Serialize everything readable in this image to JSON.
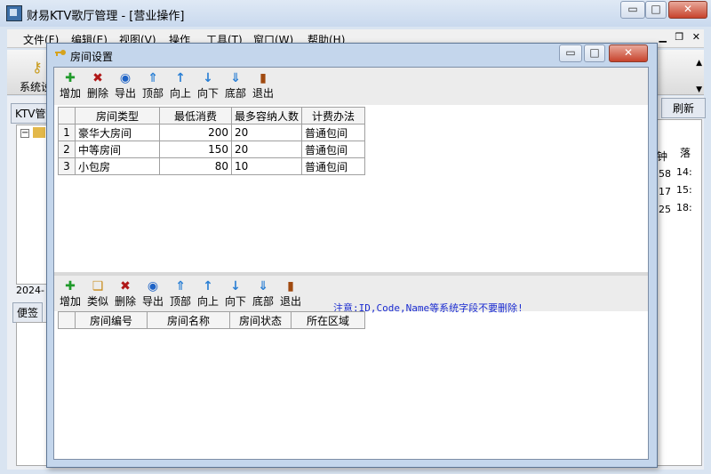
{
  "window": {
    "title": "财易KTV歌厅管理 - [营业操作]",
    "min": "▭",
    "max": "□",
    "close": "✕"
  },
  "menu": [
    "文件(F)",
    "编辑(E)",
    "视图(V)",
    "操作",
    "工具(T)",
    "窗口(W)",
    "帮助(H)"
  ],
  "background": {
    "toolbar_label": "系统设",
    "refresh": "刷新",
    "ktv_tab": "KTV管",
    "date_fragment": "2024-",
    "note_tab": "便签",
    "col_minute": "钟",
    "col_last": "落",
    "rows": [
      [
        "58",
        "14:"
      ],
      [
        "17",
        "15:"
      ],
      [
        "25",
        "18:"
      ]
    ]
  },
  "dialog": {
    "title": "房间设置",
    "toolbar_top": [
      {
        "icon": "add-icon",
        "label": "增加"
      },
      {
        "icon": "delete-icon",
        "label": "删除"
      },
      {
        "icon": "export-icon",
        "label": "导出"
      },
      {
        "icon": "top-icon",
        "label": "顶部"
      },
      {
        "icon": "up-icon",
        "label": "向上"
      },
      {
        "icon": "down-icon",
        "label": "向下"
      },
      {
        "icon": "bottom-icon",
        "label": "底部"
      },
      {
        "icon": "exit-icon",
        "label": "退出"
      }
    ],
    "grid1": {
      "headers": [
        "房间类型",
        "最低消费",
        "最多容纳人数",
        "计费办法"
      ],
      "rows": [
        [
          "1",
          "豪华大房间",
          "200",
          "20",
          "普通包间"
        ],
        [
          "2",
          "中等房间",
          "150",
          "20",
          "普通包间"
        ],
        [
          "3",
          "小包房",
          "80",
          "10",
          "普通包间"
        ]
      ]
    },
    "toolbar_bottom": [
      {
        "icon": "add-icon",
        "label": "增加"
      },
      {
        "icon": "similar-icon",
        "label": "类似"
      },
      {
        "icon": "delete-icon",
        "label": "删除"
      },
      {
        "icon": "export-icon",
        "label": "导出"
      },
      {
        "icon": "top-icon",
        "label": "顶部"
      },
      {
        "icon": "up-icon",
        "label": "向上"
      },
      {
        "icon": "down-icon",
        "label": "向下"
      },
      {
        "icon": "bottom-icon",
        "label": "底部"
      },
      {
        "icon": "exit-icon",
        "label": "退出"
      }
    ],
    "notice": "注意:ID,Code,Name等系统字段不要删除!",
    "grid2": {
      "headers": [
        "房间编号",
        "房间名称",
        "房间状态",
        "所在区域"
      ]
    }
  }
}
